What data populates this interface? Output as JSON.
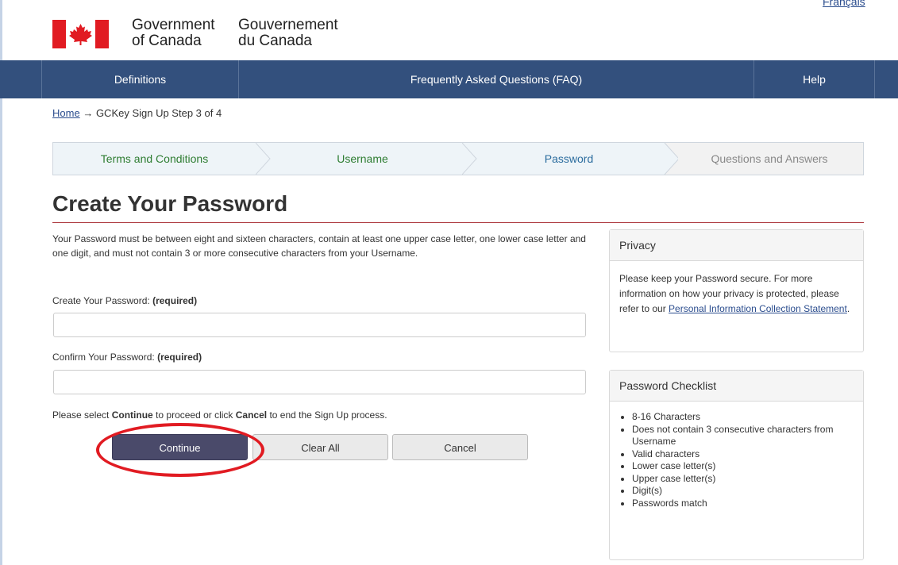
{
  "header": {
    "language_link": "Français",
    "signature_en_line1": "Government",
    "signature_en_line2": "of Canada",
    "signature_fr_line1": "Gouvernement",
    "signature_fr_line2": "du Canada"
  },
  "nav": {
    "items": [
      {
        "label": "Definitions"
      },
      {
        "label": "Frequently Asked Questions (FAQ)"
      },
      {
        "label": "Help"
      }
    ]
  },
  "breadcrumb": {
    "home": "Home",
    "arrow": "→",
    "current": "GCKey Sign Up Step 3 of 4"
  },
  "steps": [
    {
      "label": "Terms and Conditions",
      "state": "complete"
    },
    {
      "label": "Username",
      "state": "complete"
    },
    {
      "label": "Password",
      "state": "current"
    },
    {
      "label": "Questions and Answers",
      "state": "upcoming"
    }
  ],
  "main": {
    "title": "Create Your Password",
    "intro": "Your Password must be between eight and sixteen characters, contain at least one upper case letter, one lower case letter and one digit, and must not contain 3 or more consecutive characters from your Username.",
    "password_label": "Create Your Password:",
    "confirm_label": "Confirm Your Password:",
    "required": "(required)",
    "password_value": "",
    "confirm_value": "",
    "instruction_pre": "Please select ",
    "instruction_continue": "Continue",
    "instruction_mid": " to proceed or click ",
    "instruction_cancel": "Cancel",
    "instruction_post": " to end the Sign Up process.",
    "buttons": {
      "continue": "Continue",
      "clear_all": "Clear All",
      "cancel": "Cancel"
    }
  },
  "privacy": {
    "heading": "Privacy",
    "text": "Please keep your Password secure. For more information on how your privacy is protected, please refer to our ",
    "link": "Personal Information Collection Statement",
    "text_end": "."
  },
  "checklist": {
    "heading": "Password Checklist",
    "items": [
      "8-16 Characters",
      "Does not contain 3 consecutive characters from Username",
      "Valid characters",
      "Lower case letter(s)",
      "Upper case letter(s)",
      "Digit(s)",
      "Passwords match"
    ]
  },
  "colors": {
    "nav_bg": "#33507d",
    "primary_button": "#4a4a6a",
    "title_rule": "#af3c43",
    "highlight_ring": "#e11b22",
    "flag_red": "#e11b22"
  }
}
